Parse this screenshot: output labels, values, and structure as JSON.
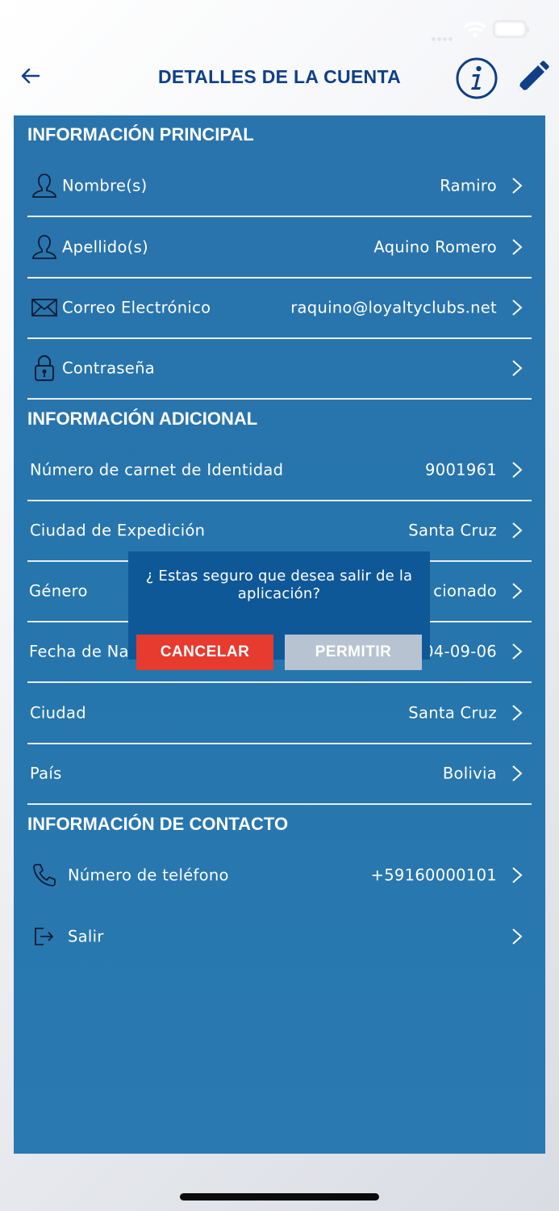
{
  "header": {
    "title": "DETALLES DE LA CUENTA"
  },
  "sections": {
    "principal": "INFORMACIÓN PRINCIPAL",
    "adicional": "INFORMACIÓN ADICIONAL",
    "contacto": "INFORMACIÓN DE CONTACTO"
  },
  "principal": {
    "nombre": {
      "label": "Nombre(s)",
      "value": "Ramiro",
      "icon": "user-icon"
    },
    "apellido": {
      "label": "Apellido(s)",
      "value": "Aquino Romero",
      "icon": "user-icon"
    },
    "correo": {
      "label": "Correo Electrónico",
      "value": "raquino@loyaltyclubs.net",
      "icon": "mail-icon"
    },
    "contrasena": {
      "label": "Contraseña",
      "value": "",
      "icon": "lock-icon"
    }
  },
  "adicional": {
    "carnet": {
      "label": "Número de carnet de Identidad",
      "value": "9001961"
    },
    "expedicion": {
      "label": "Ciudad de Expedición",
      "value": "Santa Cruz"
    },
    "genero": {
      "label": "Género",
      "value": "cionado"
    },
    "nacimiento": {
      "label": "Fecha de Nac",
      "value": "04-09-06"
    },
    "ciudad": {
      "label": "Ciudad",
      "value": "Santa Cruz"
    },
    "pais": {
      "label": "País",
      "value": "Bolivia"
    }
  },
  "contacto": {
    "telefono": {
      "label": "Número de teléfono",
      "value": "+59160000101",
      "icon": "phone-icon"
    },
    "salir": {
      "label": "Salir",
      "icon": "logout-icon"
    }
  },
  "dialog": {
    "message": "¿ Estas seguro que desea salir de la aplicación?",
    "cancel_label": "CANCELAR",
    "allow_label": "PERMITIR"
  },
  "colors": {
    "title": "#0f3f86",
    "panel": "#2675ad",
    "dialog": "#0f5898",
    "cancel": "#e63b2e",
    "allow": "#b7c3d1"
  }
}
